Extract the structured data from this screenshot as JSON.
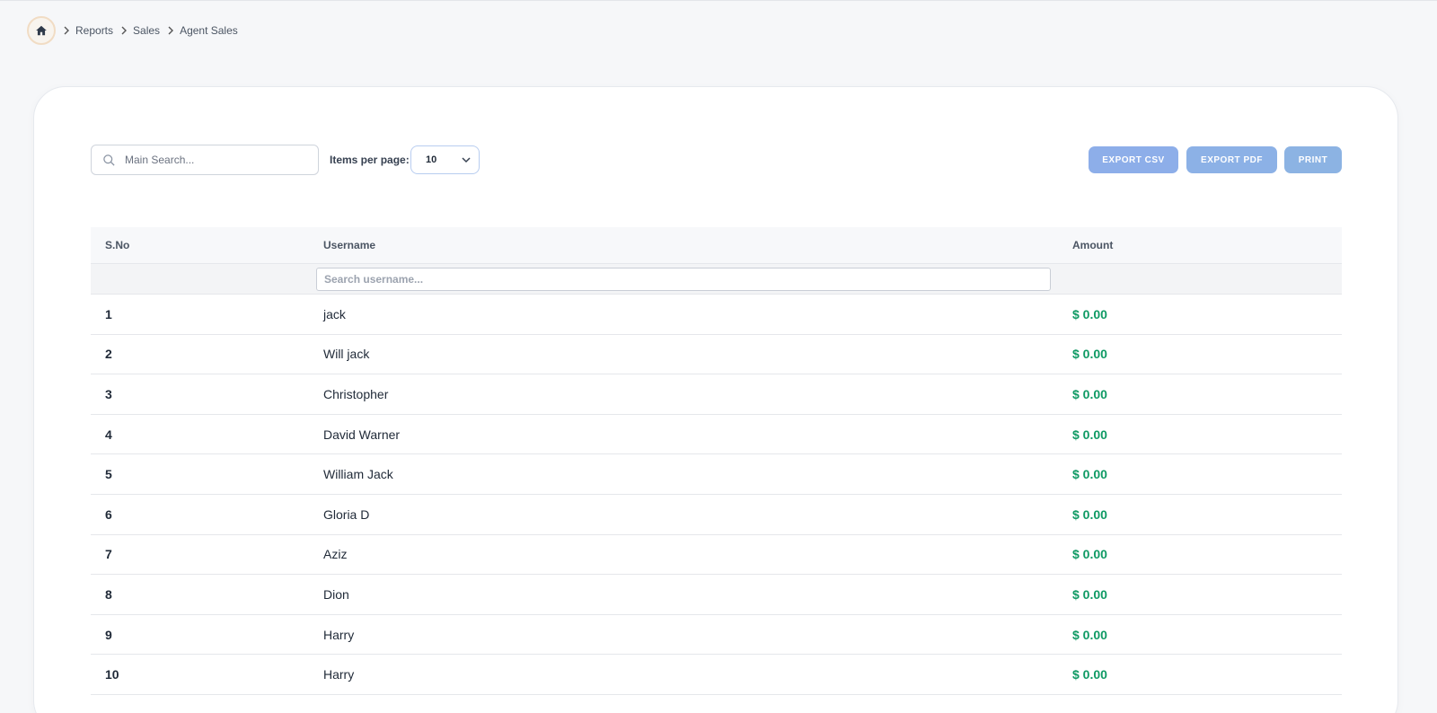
{
  "breadcrumb": {
    "home_icon": "home-icon",
    "items": [
      "Reports",
      "Sales",
      "Agent Sales"
    ]
  },
  "toolbar": {
    "search_placeholder": "Main Search...",
    "items_per_page_label": "Items per page:",
    "items_per_page_value": "10",
    "export_csv": "EXPORT CSV",
    "export_pdf": "EXPORT PDF",
    "print": "PRINT"
  },
  "table": {
    "headers": [
      "S.No",
      "Username",
      "Amount"
    ],
    "username_filter_placeholder": "Search username...",
    "rows": [
      {
        "sno": "1",
        "username": "jack",
        "amount": "$ 0.00"
      },
      {
        "sno": "2",
        "username": "Will jack",
        "amount": "$ 0.00"
      },
      {
        "sno": "3",
        "username": "Christopher",
        "amount": "$ 0.00"
      },
      {
        "sno": "4",
        "username": "David Warner",
        "amount": "$ 0.00"
      },
      {
        "sno": "5",
        "username": "William Jack",
        "amount": "$ 0.00"
      },
      {
        "sno": "6",
        "username": "Gloria D",
        "amount": "$ 0.00"
      },
      {
        "sno": "7",
        "username": "Aziz",
        "amount": "$ 0.00"
      },
      {
        "sno": "8",
        "username": "Dion",
        "amount": "$ 0.00"
      },
      {
        "sno": "9",
        "username": "Harry",
        "amount": "$ 0.00"
      },
      {
        "sno": "10",
        "username": "Harry",
        "amount": "$ 0.00"
      }
    ]
  },
  "colors": {
    "accent_button": "#8eaeea",
    "amount_green": "#0f9a64"
  }
}
